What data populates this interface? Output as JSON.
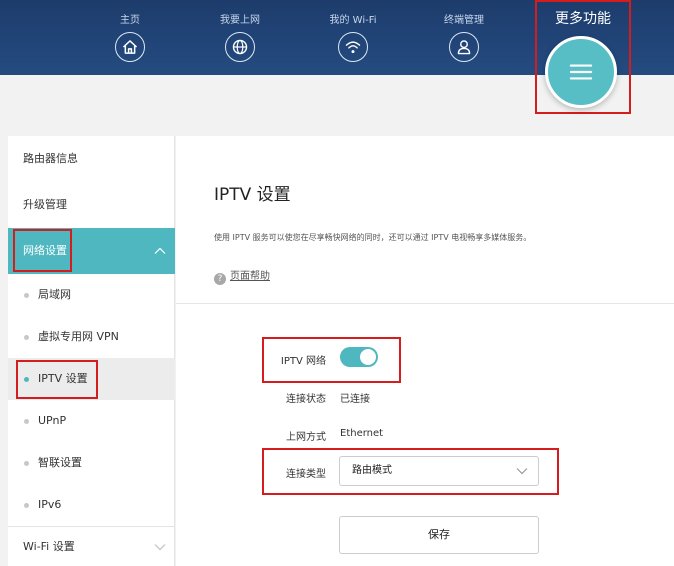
{
  "nav": {
    "items": [
      {
        "label": "主页",
        "icon": "home-icon"
      },
      {
        "label": "我要上网",
        "icon": "globe-icon"
      },
      {
        "label": "我的 Wi-Fi",
        "icon": "wifi-icon"
      },
      {
        "label": "终端管理",
        "icon": "user-icon"
      }
    ],
    "more_label": "更多功能",
    "more_icon": "menu-icon"
  },
  "sidebar": {
    "items": [
      {
        "label": "路由器信息"
      },
      {
        "label": "升级管理"
      },
      {
        "label": "网络设置",
        "expanded": true
      },
      {
        "label": "局域网"
      },
      {
        "label": "虚拟专用网 VPN"
      },
      {
        "label": "IPTV 设置",
        "active": true
      },
      {
        "label": "UPnP"
      },
      {
        "label": "智联设置"
      },
      {
        "label": "IPv6"
      },
      {
        "label": "Wi-Fi 设置",
        "expanded": false
      }
    ]
  },
  "main": {
    "title": "IPTV 设置",
    "description": "使用 IPTV 服务可以使您在尽享畅快网络的同时，还可以通过 IPTV 电视畅享多媒体服务。",
    "help_label": "页面帮助",
    "fields": {
      "iptv_label": "IPTV 网络",
      "iptv_enabled": true,
      "status_label": "连接状态",
      "status_value": "已连接",
      "mode_label": "上网方式",
      "mode_value": "Ethernet",
      "type_label": "连接类型",
      "type_value": "路由模式"
    },
    "save_label": "保存"
  },
  "colors": {
    "accent": "#4fb7c0",
    "topbar": "#1d3c6c",
    "highlight": "#d61d1d"
  }
}
